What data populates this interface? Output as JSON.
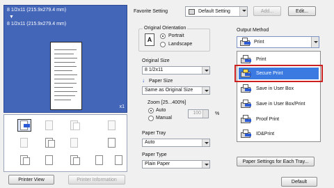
{
  "preview": {
    "paper_line1": "8 1/2x11 (215.9x279.4 mm)",
    "arrow": "▼",
    "paper_line2": "8 1/2x11 (215.9x279.4 mm)",
    "copies": "x1"
  },
  "buttons": {
    "printer_view": "Printer View",
    "printer_information": "Printer Information"
  },
  "favorite": {
    "label": "Favorite Setting",
    "value": "Default Setting",
    "add": "Add...",
    "edit": "Edit..."
  },
  "orientation": {
    "title": "Original Orientation",
    "portrait": "Portrait",
    "landscape": "Landscape",
    "selected": "portrait",
    "icon_letter": "A"
  },
  "original_size": {
    "label": "Original Size",
    "value": "8 1/2x11"
  },
  "paper_size": {
    "label": "Paper Size",
    "value": "Same as Original Size"
  },
  "zoom": {
    "label": "Zoom [25...400%]",
    "auto": "Auto",
    "manual": "Manual",
    "selected": "auto",
    "value": "100",
    "unit": "%"
  },
  "paper_tray": {
    "label": "Paper Tray",
    "value": "Auto"
  },
  "paper_type": {
    "label": "Paper Type",
    "value": "Plain Paper"
  },
  "output_method": {
    "label": "Output Method",
    "value": "Print",
    "items": [
      {
        "label": "Print"
      },
      {
        "label": "Secure Print",
        "selected": true
      },
      {
        "label": "Save in User Box"
      },
      {
        "label": "Save in User Box/Print"
      },
      {
        "label": "Proof Print"
      },
      {
        "label": "ID&Print"
      }
    ]
  },
  "paper_settings_button": "Paper Settings for Each Tray...",
  "default_button": "Default",
  "colors": {
    "preview_bg": "#4466b8",
    "selection": "#3b7ae0",
    "highlight": "#cc1f1f",
    "accent_arrow": "#2a5ad6"
  }
}
